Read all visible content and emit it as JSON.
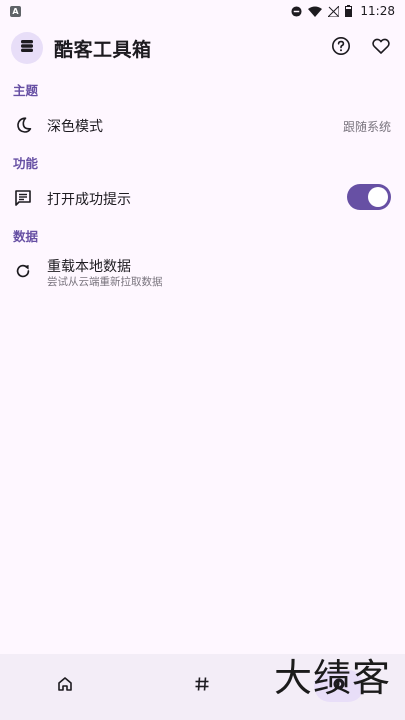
{
  "status_bar": {
    "app_badge": "A",
    "time": "11:28",
    "icons": [
      "dnd-icon",
      "wifi-icon",
      "signal-off-icon",
      "battery-icon"
    ]
  },
  "app_bar": {
    "title": "酷客工具箱",
    "logo_icon": "layers-icon",
    "actions": [
      "help-icon",
      "heart-icon"
    ]
  },
  "sections": {
    "theme": {
      "header": "主题",
      "dark_mode": {
        "label": "深色模式",
        "value": "跟随系统",
        "icon": "moon-icon"
      }
    },
    "features": {
      "header": "功能",
      "success_tip": {
        "label": "打开成功提示",
        "icon": "message-icon",
        "enabled": true
      }
    },
    "data": {
      "header": "数据",
      "reload": {
        "label": "重载本地数据",
        "subtitle": "尝试从云端重新拉取数据",
        "icon": "refresh-icon"
      }
    }
  },
  "bottom_nav": {
    "items": [
      "home-icon",
      "hash-icon",
      "settings-icon"
    ],
    "active": "settings-icon"
  },
  "watermark": "大绩客",
  "colors": {
    "background": "#FEF7FF",
    "accent": "#6750A4",
    "nav_background": "#F3EDF7",
    "active_indicator": "#E8DEF8"
  }
}
